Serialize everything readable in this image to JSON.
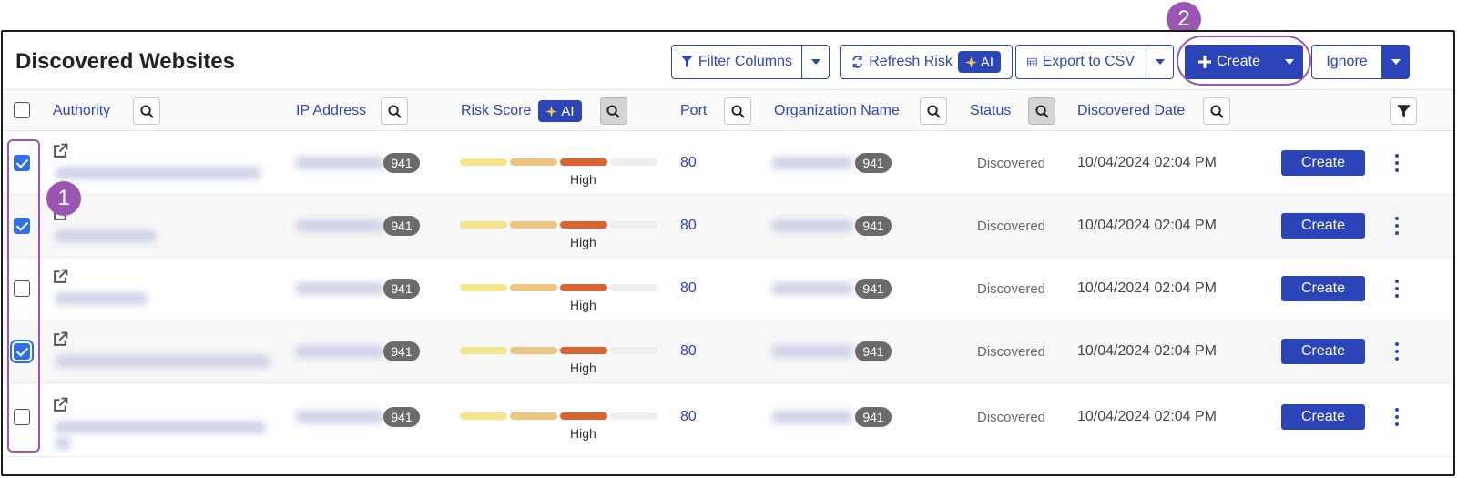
{
  "toolbar": {
    "title": "Discovered Websites",
    "filter_columns": "Filter Columns",
    "refresh_risk": "Refresh Risk",
    "ai_label": "AI",
    "export_csv": "Export to CSV",
    "create": "Create",
    "ignore": "Ignore"
  },
  "columns": {
    "authority": "Authority",
    "ip_address": "IP Address",
    "risk_score": "Risk Score",
    "risk_ai": "AI",
    "port": "Port",
    "organization_name": "Organization Name",
    "status": "Status",
    "discovered_date": "Discovered Date"
  },
  "rows": [
    {
      "checked": true,
      "ip_count": "941",
      "risk": "High",
      "port": "80",
      "org_count": "941",
      "status": "Discovered",
      "date": "10/04/2024 02:04 PM",
      "action": "Create"
    },
    {
      "checked": true,
      "ip_count": "941",
      "risk": "High",
      "port": "80",
      "org_count": "941",
      "status": "Discovered",
      "date": "10/04/2024 02:04 PM",
      "action": "Create"
    },
    {
      "checked": false,
      "ip_count": "941",
      "risk": "High",
      "port": "80",
      "org_count": "941",
      "status": "Discovered",
      "date": "10/04/2024 02:04 PM",
      "action": "Create"
    },
    {
      "checked": true,
      "ip_count": "941",
      "risk": "High",
      "port": "80",
      "org_count": "941",
      "status": "Discovered",
      "date": "10/04/2024 02:04 PM",
      "action": "Create"
    },
    {
      "checked": false,
      "ip_count": "941",
      "risk": "High",
      "port": "80",
      "org_count": "941",
      "status": "Discovered",
      "date": "10/04/2024 02:04 PM",
      "action": "Create"
    }
  ],
  "annotations": {
    "step1": "1",
    "step2": "2",
    "color": "#9a56b0"
  },
  "colors": {
    "primary": "#2b45b8",
    "risk_low": "#f4e58a",
    "risk_mid": "#ecc681",
    "risk_high": "#db6330",
    "risk_empty": "#eeeeee"
  }
}
